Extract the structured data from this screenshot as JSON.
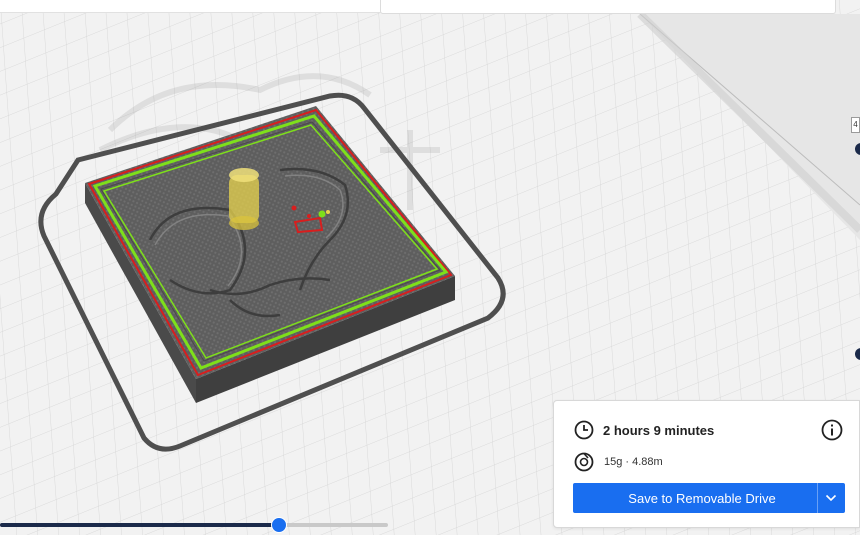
{
  "print_info": {
    "time_label": "2 hours 9 minutes",
    "material_label": "15g · 4.88m",
    "save_button_label": "Save to Removable Drive"
  },
  "layer_slider": {
    "progress": 0.72
  },
  "side_tab": {
    "label": "4"
  },
  "colors": {
    "accent": "#196ef0",
    "slider_track": "#1b2a4a",
    "wall_outer": "#d81e1e",
    "wall_inner": "#7ee01a",
    "support": "#e8d44d"
  },
  "icons": {
    "time": "clock-icon",
    "info": "info-icon",
    "material": "spool-icon",
    "save_menu": "chevron-down-icon"
  }
}
